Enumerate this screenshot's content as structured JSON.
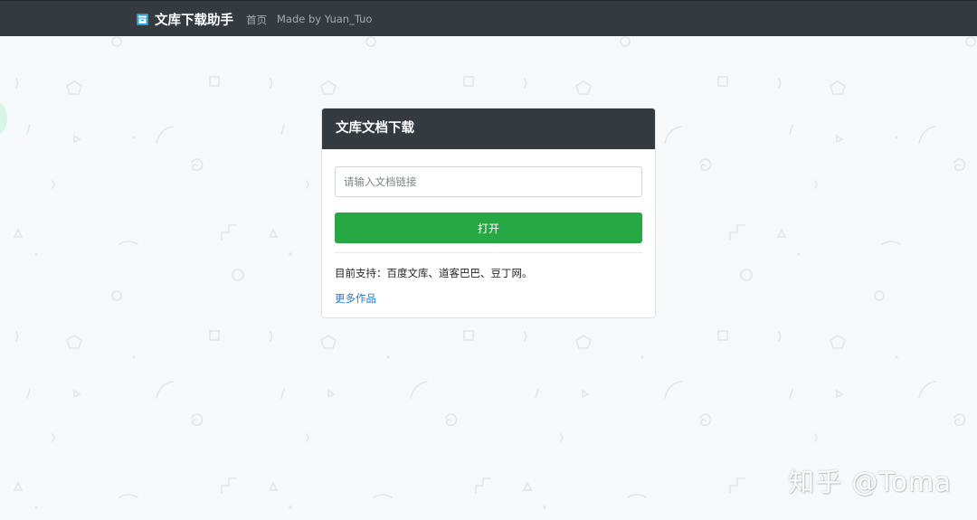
{
  "navbar": {
    "brand": "文库下载助手",
    "links": [
      "首页",
      "Made by Yuan_Tuo"
    ]
  },
  "card": {
    "title": "文库文档下载",
    "input_placeholder": "请输入文档链接",
    "input_value": "",
    "button_label": "打开",
    "support_text": "目前支持：百度文库、道客巴巴、豆丁网。",
    "more_link": "更多作品"
  },
  "watermark": "知乎 @Toma",
  "colors": {
    "navbar_bg": "#343a40",
    "button_bg": "#28a745",
    "link": "#1a7ad4",
    "brand_icon": "#2a9fd6"
  },
  "icons": {
    "brand": "archive-icon"
  }
}
